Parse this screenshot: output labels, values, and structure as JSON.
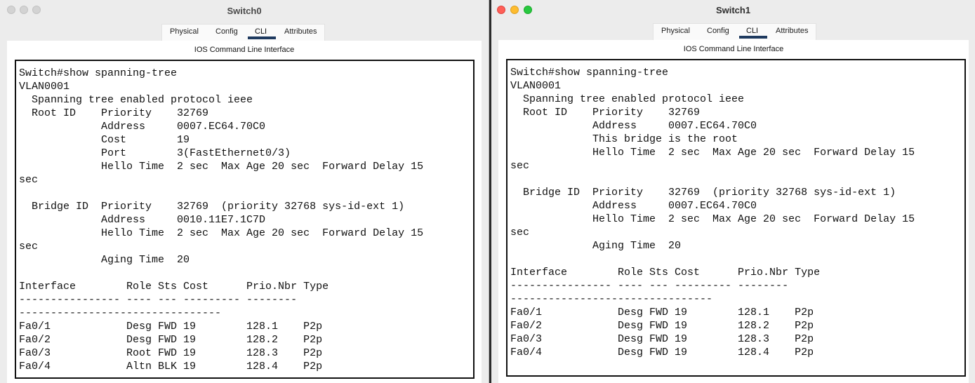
{
  "switch0": {
    "title": "Switch0",
    "tabs": [
      "Physical",
      "Config",
      "CLI",
      "Attributes"
    ],
    "active_tab": "CLI",
    "panel_label": "IOS Command Line Interface",
    "console": "Switch#show spanning-tree\nVLAN0001\n  Spanning tree enabled protocol ieee\n  Root ID    Priority    32769\n             Address     0007.EC64.70C0\n             Cost        19\n             Port        3(FastEthernet0/3)\n             Hello Time  2 sec  Max Age 20 sec  Forward Delay 15\nsec\n\n  Bridge ID  Priority    32769  (priority 32768 sys-id-ext 1)\n             Address     0010.11E7.1C7D\n             Hello Time  2 sec  Max Age 20 sec  Forward Delay 15\nsec\n             Aging Time  20\n\nInterface        Role Sts Cost      Prio.Nbr Type\n---------------- ---- --- --------- --------\n--------------------------------\nFa0/1            Desg FWD 19        128.1    P2p\nFa0/2            Desg FWD 19        128.2    P2p\nFa0/3            Root FWD 19        128.3    P2p\nFa0/4            Altn BLK 19        128.4    P2p"
  },
  "switch1": {
    "title": "Switch1",
    "tabs": [
      "Physical",
      "Config",
      "CLI",
      "Attributes"
    ],
    "active_tab": "CLI",
    "panel_label": "IOS Command Line Interface",
    "console": "Switch#show spanning-tree\nVLAN0001\n  Spanning tree enabled protocol ieee\n  Root ID    Priority    32769\n             Address     0007.EC64.70C0\n             This bridge is the root\n             Hello Time  2 sec  Max Age 20 sec  Forward Delay 15\nsec\n\n  Bridge ID  Priority    32769  (priority 32768 sys-id-ext 1)\n             Address     0007.EC64.70C0\n             Hello Time  2 sec  Max Age 20 sec  Forward Delay 15\nsec\n             Aging Time  20\n\nInterface        Role Sts Cost      Prio.Nbr Type\n---------------- ---- --- --------- --------\n--------------------------------\nFa0/1            Desg FWD 19        128.1    P2p\nFa0/2            Desg FWD 19        128.2    P2p\nFa0/3            Desg FWD 19        128.3    P2p\nFa0/4            Desg FWD 19        128.4    P2p"
  },
  "colors": {
    "active_tab_underline": "#1e3a5f",
    "close": "#ff5f57",
    "minimize": "#febc2e",
    "zoom": "#28c840"
  }
}
